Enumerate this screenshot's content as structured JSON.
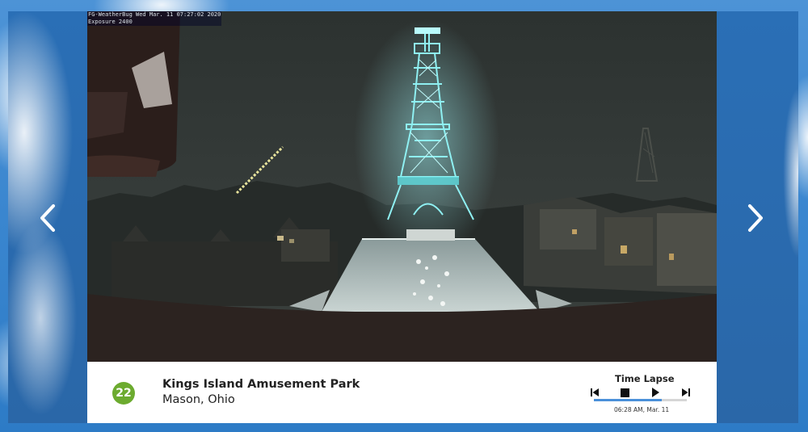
{
  "camera": {
    "stamp_line1": "FG-WeatherBug Wed Mar. 11 07:27:02 2020",
    "stamp_line2": "Exposure 2400"
  },
  "location": {
    "rank": "22",
    "name": "Kings Island Amusement Park",
    "place": "Mason, Ohio"
  },
  "timelapse": {
    "title": "Time Lapse",
    "progress": 0.73,
    "time_label": "06:28 AM, Mar. 11"
  },
  "icons": {
    "prev": "chevron-left-icon",
    "next": "chevron-right-icon",
    "skip_back": "skip-back-icon",
    "stop": "stop-icon",
    "play": "play-icon",
    "skip_forward": "skip-forward-icon"
  },
  "colors": {
    "frame_blue": "#2f7fc9",
    "badge_green": "#6cab2f",
    "progress_blue": "#4a90d9",
    "tower_lights": "#7fe6ea"
  }
}
